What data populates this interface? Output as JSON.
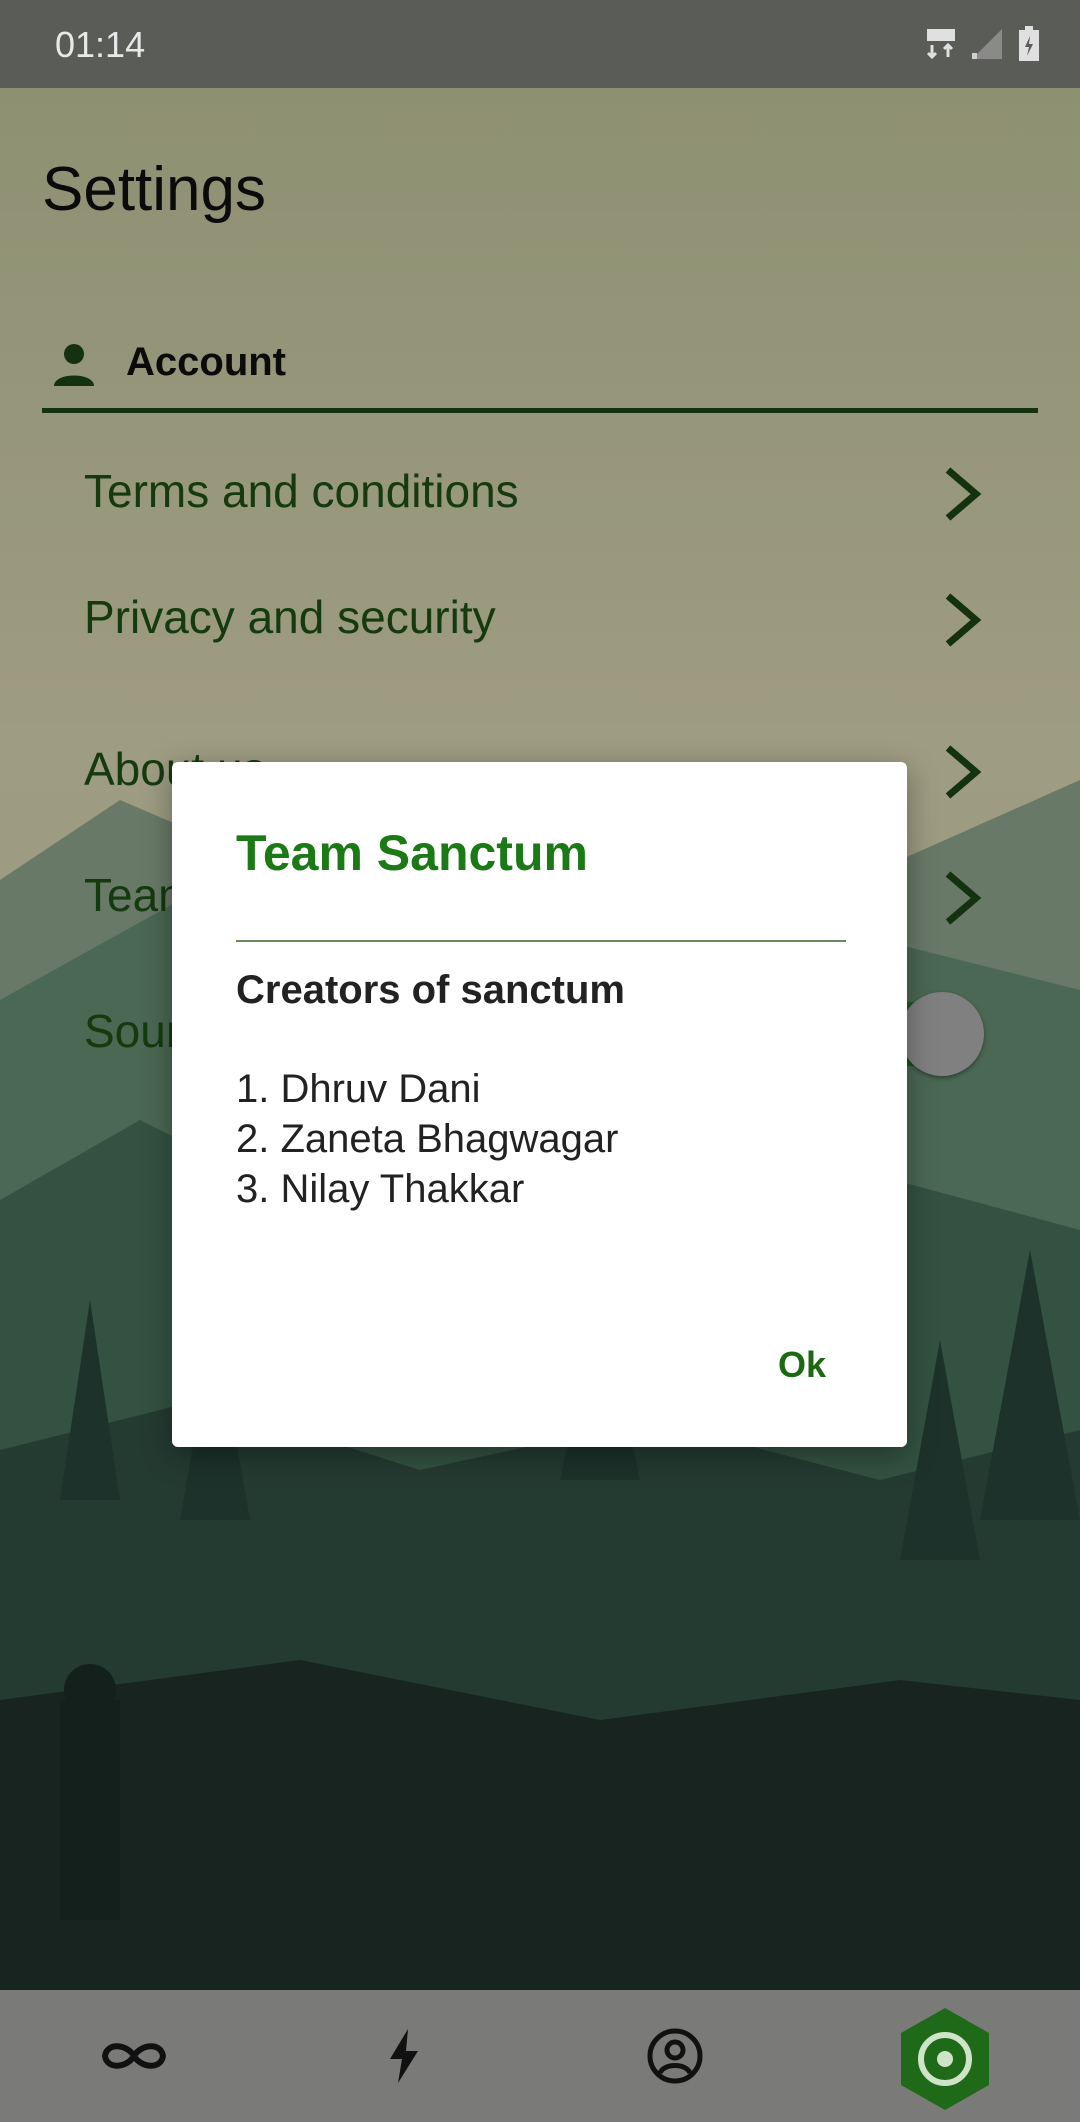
{
  "status_bar": {
    "time": "01:14"
  },
  "page": {
    "title": "Settings"
  },
  "section": {
    "label": "Account",
    "icon": "person-icon"
  },
  "settings_items": [
    {
      "label": "Terms and conditions"
    },
    {
      "label": "Privacy and security"
    },
    {
      "label": "About us"
    },
    {
      "label": "Team Sanctum"
    },
    {
      "label": "Sound"
    }
  ],
  "sound_toggle": {
    "on": true
  },
  "dialog": {
    "title": "Team Sanctum",
    "subtitle": "Creators of sanctum",
    "members": [
      "1. Dhruv Dani",
      "2. Zaneta Bhagwagar",
      "3. Nilay Thakkar"
    ],
    "ok_label": "Ok"
  },
  "bottom_nav": [
    {
      "icon": "infinity-icon"
    },
    {
      "icon": "lightning-icon"
    },
    {
      "icon": "profile-icon"
    },
    {
      "icon": "settings-target-icon",
      "active": true
    }
  ],
  "colors": {
    "accent_green": "#1b7a15",
    "dark_green": "#1e5616",
    "active_nav": "#1e6a18"
  }
}
